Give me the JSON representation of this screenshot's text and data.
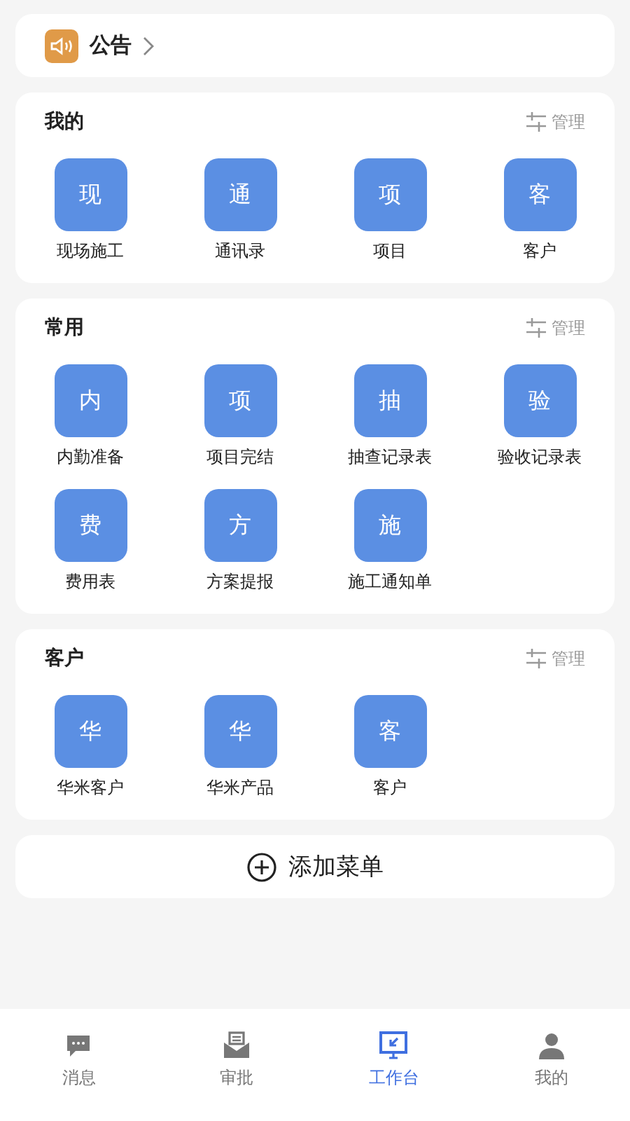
{
  "notice": {
    "title": "公告"
  },
  "sections": [
    {
      "title": "我的",
      "manage": "管理",
      "items": [
        {
          "glyph": "现",
          "label": "现场施工"
        },
        {
          "glyph": "通",
          "label": "通讯录"
        },
        {
          "glyph": "项",
          "label": "项目"
        },
        {
          "glyph": "客",
          "label": "客户"
        }
      ]
    },
    {
      "title": "常用",
      "manage": "管理",
      "items": [
        {
          "glyph": "内",
          "label": "内勤准备"
        },
        {
          "glyph": "项",
          "label": "项目完结"
        },
        {
          "glyph": "抽",
          "label": "抽查记录表"
        },
        {
          "glyph": "验",
          "label": "验收记录表"
        },
        {
          "glyph": "费",
          "label": "费用表"
        },
        {
          "glyph": "方",
          "label": "方案提报"
        },
        {
          "glyph": "施",
          "label": "施工通知单"
        }
      ]
    },
    {
      "title": "客户",
      "manage": "管理",
      "items": [
        {
          "glyph": "华",
          "label": "华米客户"
        },
        {
          "glyph": "华",
          "label": "华米产品"
        },
        {
          "glyph": "客",
          "label": "客户"
        }
      ]
    }
  ],
  "add_menu": "添加菜单",
  "tabs": [
    {
      "kind": "message",
      "label": "消息",
      "selected": false
    },
    {
      "kind": "approval",
      "label": "审批",
      "selected": false
    },
    {
      "kind": "workbench",
      "label": "工作台",
      "selected": true
    },
    {
      "kind": "profile",
      "label": "我的",
      "selected": false
    }
  ]
}
